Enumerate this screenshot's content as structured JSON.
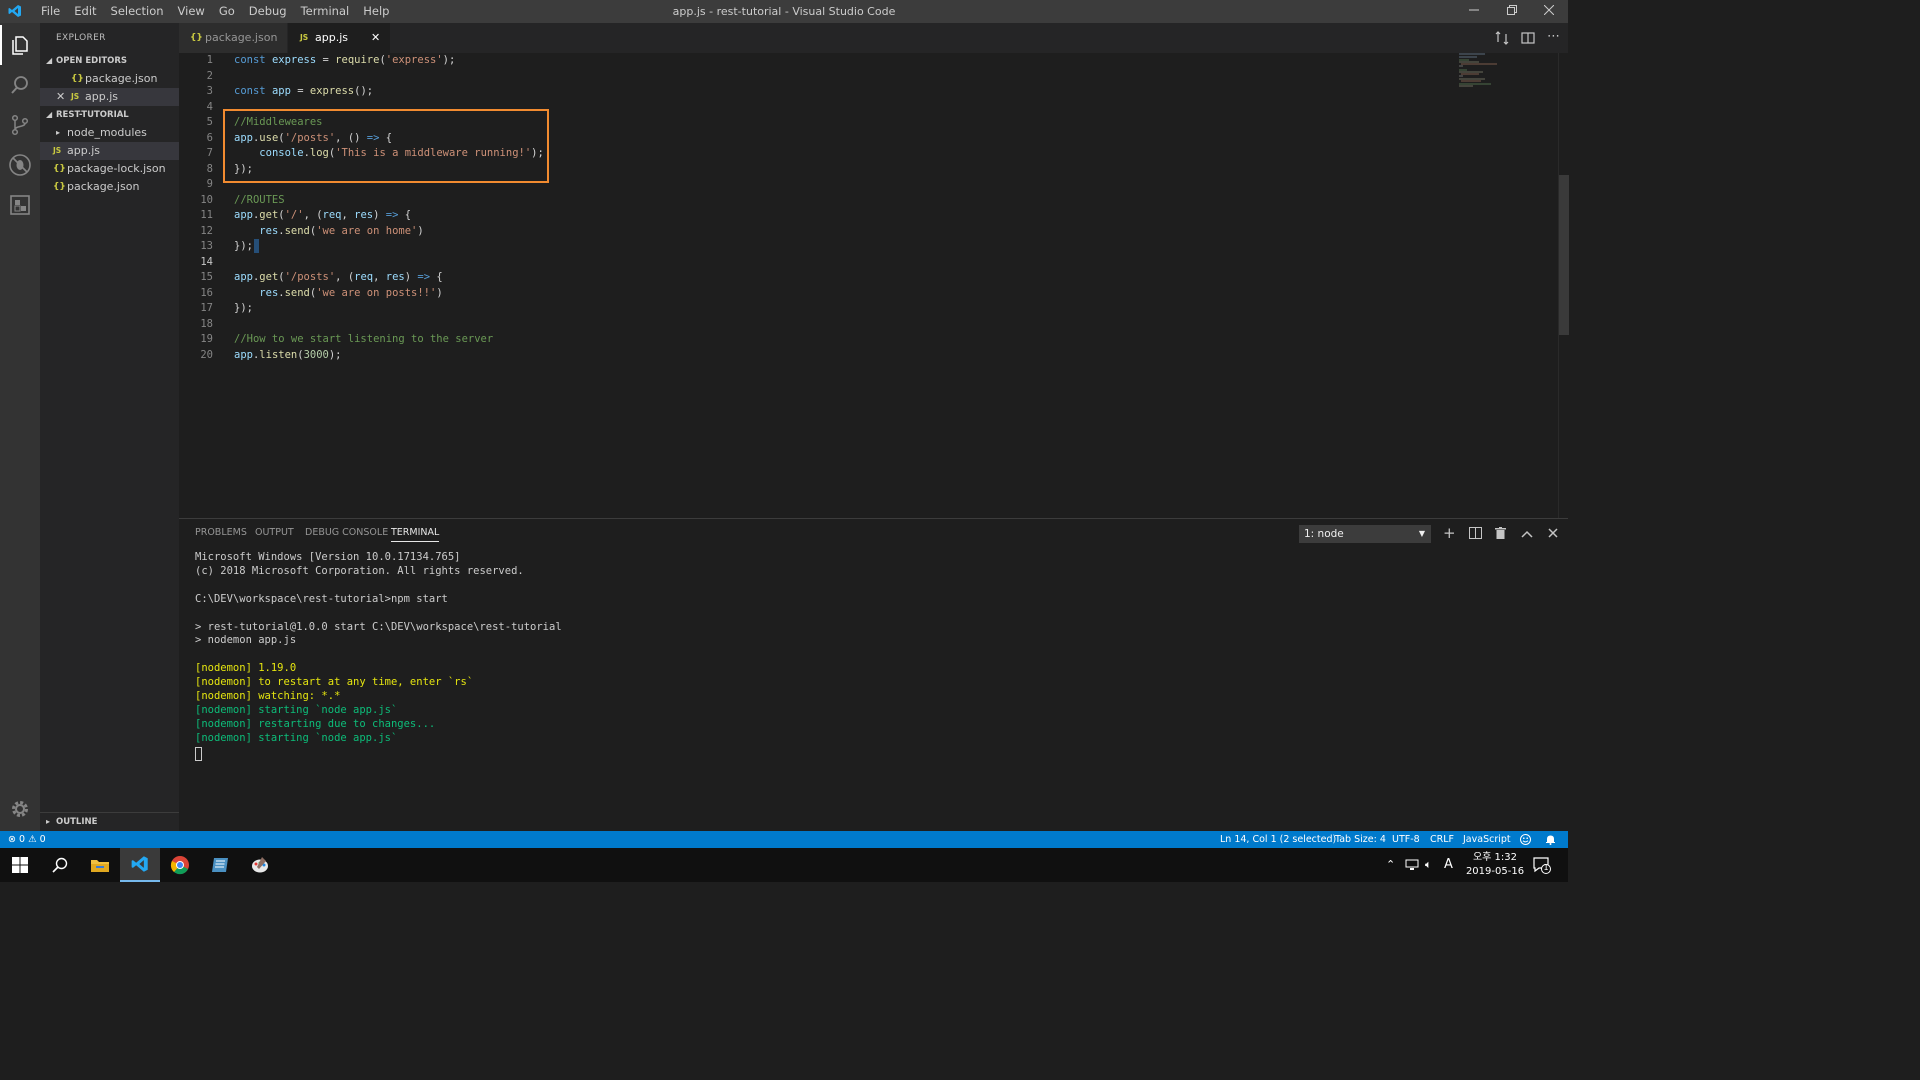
{
  "window": {
    "title": "app.js - rest-tutorial - Visual Studio Code",
    "menu": [
      "File",
      "Edit",
      "Selection",
      "View",
      "Go",
      "Debug",
      "Terminal",
      "Help"
    ]
  },
  "sidebar": {
    "title": "EXPLORER",
    "open_editors_label": "OPEN EDITORS",
    "open_editors": [
      {
        "icon": "{}",
        "name": "package.json"
      },
      {
        "icon": "JS",
        "name": "app.js"
      }
    ],
    "folder_label": "REST-TUTORIAL",
    "files": [
      {
        "icon": "",
        "name": "node_modules"
      },
      {
        "icon": "JS",
        "name": "app.js"
      },
      {
        "icon": "{}",
        "name": "package-lock.json"
      },
      {
        "icon": "{}",
        "name": "package.json"
      }
    ],
    "outline_label": "OUTLINE"
  },
  "tabs": [
    {
      "icon": "{}",
      "label": "package.json"
    },
    {
      "icon": "JS",
      "label": "app.js"
    }
  ],
  "editor": {
    "line_numbers": [
      "1",
      "2",
      "3",
      "4",
      "5",
      "6",
      "7",
      "8",
      "9",
      "10",
      "11",
      "12",
      "13",
      "14",
      "15",
      "16",
      "17",
      "18",
      "19",
      "20"
    ],
    "lines": [
      [
        [
          "kw",
          "const"
        ],
        [
          "pn",
          " "
        ],
        [
          "vr",
          "express"
        ],
        [
          "pn",
          " = "
        ],
        [
          "fn",
          "require"
        ],
        [
          "pn",
          "("
        ],
        [
          "st",
          "'express'"
        ],
        [
          "pn",
          ");"
        ]
      ],
      [],
      [
        [
          "kw",
          "const"
        ],
        [
          "pn",
          " "
        ],
        [
          "vr",
          "app"
        ],
        [
          "pn",
          " = "
        ],
        [
          "fn",
          "express"
        ],
        [
          "pn",
          "();"
        ]
      ],
      [],
      [
        [
          "cm",
          "//Middleweares"
        ]
      ],
      [
        [
          "vr",
          "app"
        ],
        [
          "pn",
          "."
        ],
        [
          "fn",
          "use"
        ],
        [
          "pn",
          "("
        ],
        [
          "st",
          "'/posts'"
        ],
        [
          "pn",
          ", () "
        ],
        [
          "kw",
          "=>"
        ],
        [
          "pn",
          " {"
        ]
      ],
      [
        [
          "pn",
          "    "
        ],
        [
          "vr",
          "console"
        ],
        [
          "pn",
          "."
        ],
        [
          "fn",
          "log"
        ],
        [
          "pn",
          "("
        ],
        [
          "st",
          "'This is a middleware running!'"
        ],
        [
          "pn",
          ");"
        ]
      ],
      [
        [
          "pn",
          "});"
        ]
      ],
      [],
      [
        [
          "cm",
          "//ROUTES"
        ]
      ],
      [
        [
          "vr",
          "app"
        ],
        [
          "pn",
          "."
        ],
        [
          "fn",
          "get"
        ],
        [
          "pn",
          "("
        ],
        [
          "st",
          "'/'"
        ],
        [
          "pn",
          ", ("
        ],
        [
          "vr",
          "req"
        ],
        [
          "pn",
          ", "
        ],
        [
          "vr",
          "res"
        ],
        [
          "pn",
          ") "
        ],
        [
          "kw",
          "=>"
        ],
        [
          "pn",
          " {"
        ]
      ],
      [
        [
          "pn",
          "    "
        ],
        [
          "vr",
          "res"
        ],
        [
          "pn",
          "."
        ],
        [
          "fn",
          "send"
        ],
        [
          "pn",
          "("
        ],
        [
          "st",
          "'we are on home'"
        ],
        [
          "pn",
          ")"
        ]
      ],
      [
        [
          "pn",
          "});"
        ]
      ],
      [],
      [
        [
          "vr",
          "app"
        ],
        [
          "pn",
          "."
        ],
        [
          "fn",
          "get"
        ],
        [
          "pn",
          "("
        ],
        [
          "st",
          "'/posts'"
        ],
        [
          "pn",
          ", ("
        ],
        [
          "vr",
          "req"
        ],
        [
          "pn",
          ", "
        ],
        [
          "vr",
          "res"
        ],
        [
          "pn",
          ") "
        ],
        [
          "kw",
          "=>"
        ],
        [
          "pn",
          " {"
        ]
      ],
      [
        [
          "pn",
          "    "
        ],
        [
          "vr",
          "res"
        ],
        [
          "pn",
          "."
        ],
        [
          "fn",
          "send"
        ],
        [
          "pn",
          "("
        ],
        [
          "st",
          "'we are on posts!!'"
        ],
        [
          "pn",
          ")"
        ]
      ],
      [
        [
          "pn",
          "});"
        ]
      ],
      [],
      [
        [
          "cm",
          "//How to we start listening to the server"
        ]
      ],
      [
        [
          "vr",
          "app"
        ],
        [
          "pn",
          "."
        ],
        [
          "fn",
          "listen"
        ],
        [
          "pn",
          "("
        ],
        [
          "nm",
          "3000"
        ],
        [
          "pn",
          ");"
        ]
      ]
    ]
  },
  "panel": {
    "tabs": [
      "PROBLEMS",
      "OUTPUT",
      "DEBUG CONSOLE",
      "TERMINAL"
    ],
    "terminal_select": "1: node",
    "terminal_lines": [
      {
        "t": "Microsoft Windows [Version 10.0.17134.765]",
        "c": "#cccccc"
      },
      {
        "t": "(c) 2018 Microsoft Corporation. All rights reserved.",
        "c": "#cccccc"
      },
      {
        "t": "",
        "c": "#cccccc"
      },
      {
        "t": "C:\\DEV\\workspace\\rest-tutorial>npm start",
        "c": "#cccccc"
      },
      {
        "t": "",
        "c": "#cccccc"
      },
      {
        "t": "> rest-tutorial@1.0.0 start C:\\DEV\\workspace\\rest-tutorial",
        "c": "#cccccc"
      },
      {
        "t": "> nodemon app.js",
        "c": "#cccccc"
      },
      {
        "t": "",
        "c": "#cccccc"
      },
      {
        "t": "[nodemon] 1.19.0",
        "c": "#e5e510"
      },
      {
        "t": "[nodemon] to restart at any time, enter `rs`",
        "c": "#e5e510"
      },
      {
        "t": "[nodemon] watching: *.*",
        "c": "#e5e510"
      },
      {
        "t": "[nodemon] starting `node app.js`",
        "c": "#0dbc79"
      },
      {
        "t": "[nodemon] restarting due to changes...",
        "c": "#0dbc79"
      },
      {
        "t": "[nodemon] starting `node app.js`",
        "c": "#0dbc79"
      }
    ]
  },
  "statusbar": {
    "errors": "0",
    "warnings": "0",
    "position": "Ln 14, Col 1 (2 selected)",
    "tab_size": "Tab Size: 4",
    "encoding": "UTF-8",
    "eol": "CRLF",
    "language": "JavaScript"
  },
  "taskbar": {
    "ime": "A",
    "time": "오후 1:32",
    "date": "2019-05-16",
    "notification_count": "1"
  },
  "colors": {
    "accent": "#007acc",
    "highlight_box": "#f28b30"
  }
}
